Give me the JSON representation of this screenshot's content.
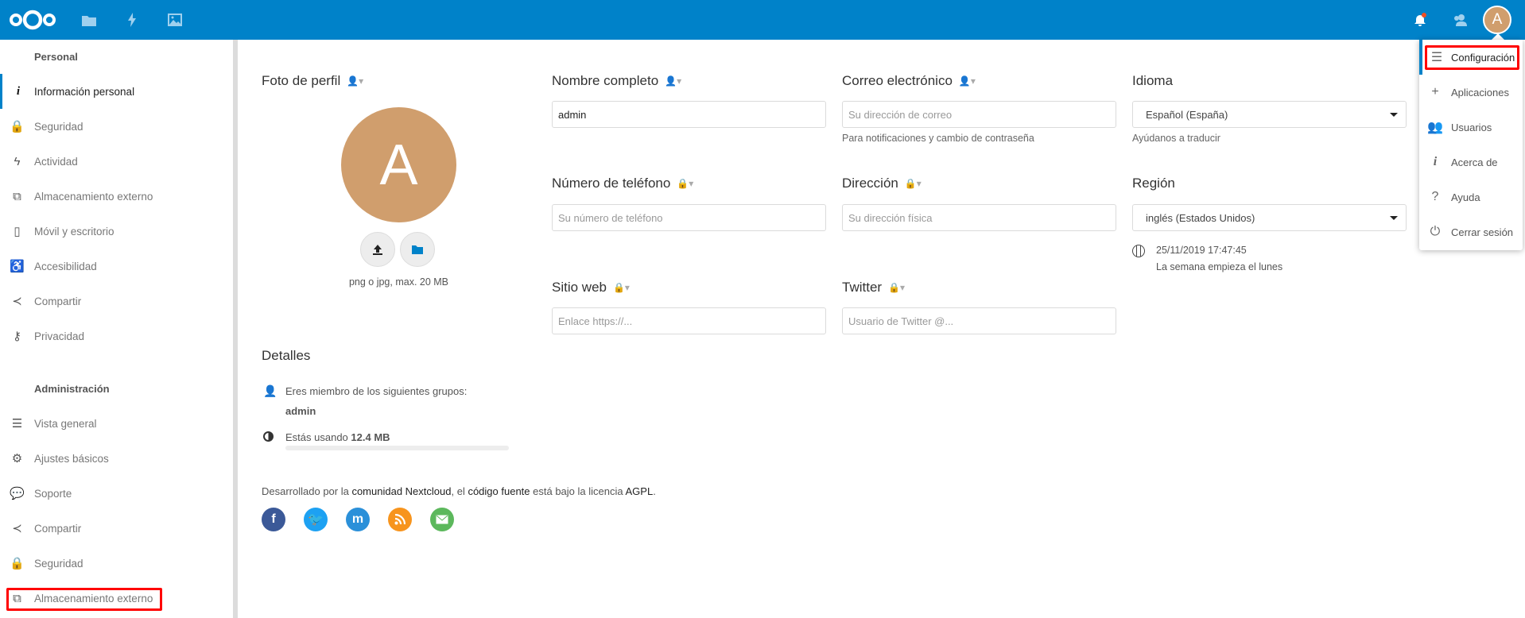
{
  "header": {
    "apps": [
      {
        "icon": "files-icon"
      },
      {
        "icon": "activity-icon"
      },
      {
        "icon": "photos-icon"
      }
    ],
    "notification_icon": "bell-icon",
    "contacts_icon": "contacts-icon",
    "avatar_letter": "A"
  },
  "sidebar": {
    "personal_heading": "Personal",
    "personal_items": [
      {
        "label": "Información personal",
        "icon": "info-icon",
        "active": true
      },
      {
        "label": "Seguridad",
        "icon": "lock-icon"
      },
      {
        "label": "Actividad",
        "icon": "activity-icon"
      },
      {
        "label": "Almacenamiento externo",
        "icon": "external-link-icon"
      },
      {
        "label": "Móvil y escritorio",
        "icon": "phone-icon"
      },
      {
        "label": "Accesibilidad",
        "icon": "accessibility-icon"
      },
      {
        "label": "Compartir",
        "icon": "share-icon"
      },
      {
        "label": "Privacidad",
        "icon": "key-icon"
      }
    ],
    "admin_heading": "Administración",
    "admin_items": [
      {
        "label": "Vista general",
        "icon": "list-icon"
      },
      {
        "label": "Ajustes básicos",
        "icon": "gear-icon"
      },
      {
        "label": "Soporte",
        "icon": "speech-bubble-icon"
      },
      {
        "label": "Compartir",
        "icon": "share-icon"
      },
      {
        "label": "Seguridad",
        "icon": "lock-icon"
      },
      {
        "label": "Almacenamiento externo",
        "icon": "external-link-icon",
        "highlighted": true
      }
    ]
  },
  "profile": {
    "photo_heading": "Foto de perfil",
    "avatar_letter": "A",
    "avatar_color": "#d09e6d",
    "photo_hint": "png o jpg, max. 20 MB",
    "full_name": {
      "label": "Nombre completo",
      "value": "admin"
    },
    "email": {
      "label": "Correo electrónico",
      "placeholder": "Su dirección de correo",
      "hint": "Para notificaciones y cambio de contraseña"
    },
    "language": {
      "label": "Idioma",
      "value": "Español (España)",
      "hint": "Ayúdanos a traducir"
    },
    "phone": {
      "label": "Número de teléfono",
      "placeholder": "Su número de teléfono"
    },
    "address": {
      "label": "Dirección",
      "placeholder": "Su dirección física"
    },
    "region": {
      "label": "Región",
      "value": "inglés (Estados Unidos)",
      "datetime": "25/11/2019 17:47:45",
      "week_start": "La semana empieza el lunes"
    },
    "website": {
      "label": "Sitio web",
      "placeholder": "Enlace https://..."
    },
    "twitter": {
      "label": "Twitter",
      "placeholder": "Usuario de Twitter @..."
    }
  },
  "details": {
    "heading": "Detalles",
    "groups_text": "Eres miembro de los siguientes grupos:",
    "groups": "admin",
    "usage_prefix": "Estás usando",
    "usage_value": "12.4 MB",
    "usage_fraction": 0.0
  },
  "footer": {
    "t1": "Desarrollado por la ",
    "link1": "comunidad Nextcloud",
    "t2": ", el ",
    "link2": "código fuente",
    "t3": " está bajo la licencia ",
    "link3": "AGPL",
    "t4": ".",
    "social": [
      {
        "icon": "facebook-icon",
        "color": "#3b5998"
      },
      {
        "icon": "twitter-icon",
        "color": "#1da1f2"
      },
      {
        "icon": "mastodon-icon",
        "color": "#2b90d9"
      },
      {
        "icon": "rss-icon",
        "color": "#f7941d"
      },
      {
        "icon": "mail-icon",
        "color": "#5cb85c"
      }
    ]
  },
  "menu": {
    "items": [
      {
        "label": "Configuración",
        "icon": "settings-list-icon",
        "active": true
      },
      {
        "label": "Aplicaciones",
        "icon": "plus-icon"
      },
      {
        "label": "Usuarios",
        "icon": "users-icon"
      },
      {
        "label": "Acerca de",
        "icon": "info-icon"
      },
      {
        "label": "Ayuda",
        "icon": "help-icon"
      },
      {
        "label": "Cerrar sesión",
        "icon": "power-icon"
      }
    ]
  },
  "colors": {
    "primary": "#0082c9",
    "highlight": "#ff0000"
  }
}
